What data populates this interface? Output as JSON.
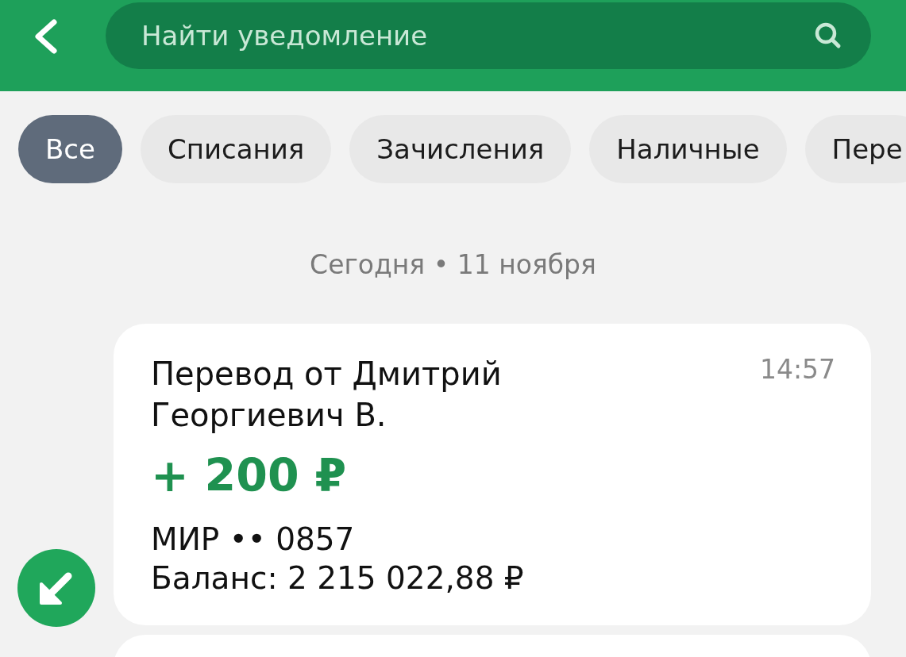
{
  "header": {
    "search": {
      "placeholder": "Найти уведомление"
    }
  },
  "filters": [
    {
      "label": "Все",
      "selected": true
    },
    {
      "label": "Списания",
      "selected": false
    },
    {
      "label": "Зачисления",
      "selected": false
    },
    {
      "label": "Наличные",
      "selected": false
    },
    {
      "label": "Пере",
      "selected": false
    }
  ],
  "date_heading": "Сегодня • 11 ноября",
  "notifications": [
    {
      "kind": "incoming",
      "title": "Перевод от Дмитрий Георгиевич В.",
      "time": "14:57",
      "amount": "+ 200 ₽",
      "card": "МИР •• 0857",
      "balance": "Баланс: 2 215 022,88 ₽"
    }
  ]
}
